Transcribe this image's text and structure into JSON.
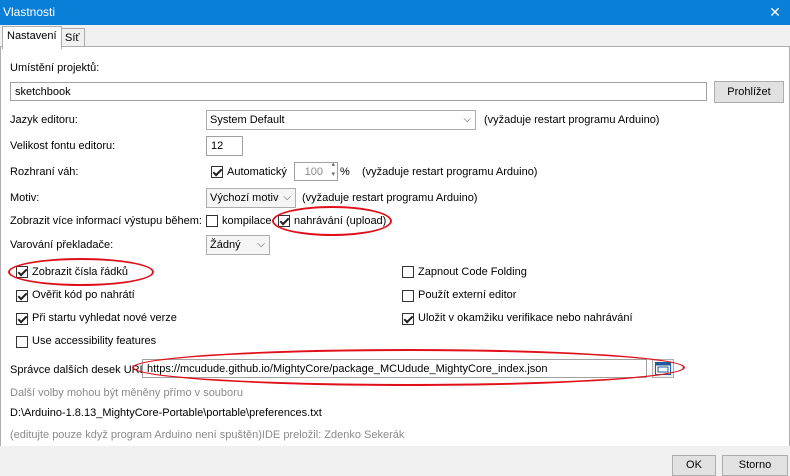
{
  "window": {
    "title": "Vlastnosti"
  },
  "tabs": [
    "Nastavení",
    "Síť"
  ],
  "sketchbook": {
    "label": "Umístění projektů:",
    "value": "sketchbook",
    "browse": "Prohlížet"
  },
  "language": {
    "label": "Jazyk editoru:",
    "value": "System Default",
    "note": "(vyžaduje restart programu Arduino)"
  },
  "font_size": {
    "label": "Velikost fontu editoru:",
    "value": "12"
  },
  "scale": {
    "label": "Rozhraní váh:",
    "auto_label": "Automatický",
    "value": "100",
    "unit": "%",
    "note": "(vyžaduje restart programu Arduino)"
  },
  "theme": {
    "label": "Motiv:",
    "value": "Výchozí motiv",
    "note": "(vyžaduje restart programu Arduino)"
  },
  "verbose": {
    "label": "Zobrazit více informací výstupu během:",
    "compile": "kompilace",
    "upload": "nahrávání (upload)"
  },
  "warnings": {
    "label": "Varování překladače:",
    "value": "Žádný"
  },
  "options": {
    "line_numbers": "Zobrazit čísla řádků",
    "verify": "Ověřit kód po nahrátí",
    "check_updates": "Při startu vyhledat nové verze",
    "accessibility": "Use accessibility features",
    "code_folding": "Zapnout Code Folding",
    "external_editor": "Použít externí editor",
    "save_verify": "Uložit v okamžiku verifikace nebo nahrávání"
  },
  "board_urls": {
    "label": "Správce dalších desek URL:",
    "value": "https://mcudude.github.io/MightyCore/package_MCUdude_MightyCore_index.json"
  },
  "footer": {
    "more_options": "Další volby mohou být měněny přímo v souboru",
    "path": "D:\\Arduino-1.8.13_MightyCore-Portable\\portable\\preferences.txt",
    "edit_note": "(editujte pouze když program Arduino není spuštěn)IDE preložil: Zdenko Sekerák"
  },
  "buttons": {
    "ok": "OK",
    "cancel": "Storno"
  },
  "colors": {
    "titlebar": "#0a7fd8",
    "highlight": "#e0101a"
  }
}
